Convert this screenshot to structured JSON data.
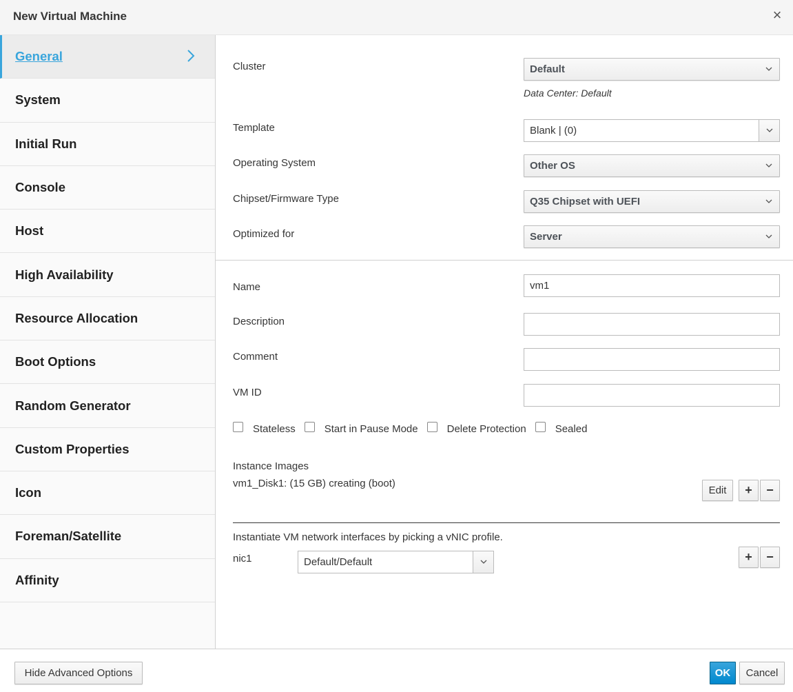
{
  "dialog": {
    "title": "New Virtual Machine",
    "close_icon": "close-icon",
    "close_glyph": "×"
  },
  "sidebar": {
    "items": [
      {
        "label": "General",
        "active": true
      },
      {
        "label": "System"
      },
      {
        "label": "Initial Run"
      },
      {
        "label": "Console"
      },
      {
        "label": "Host"
      },
      {
        "label": "High Availability"
      },
      {
        "label": "Resource Allocation"
      },
      {
        "label": "Boot Options"
      },
      {
        "label": "Random Generator"
      },
      {
        "label": "Custom Properties"
      },
      {
        "label": "Icon"
      },
      {
        "label": "Foreman/Satellite"
      },
      {
        "label": "Affinity"
      }
    ],
    "active_icon": "chevron-right-icon"
  },
  "general": {
    "cluster": {
      "label": "Cluster",
      "value": "Default",
      "note": "Data Center: Default"
    },
    "template": {
      "label": "Template",
      "value": "Blank |  (0)"
    },
    "os": {
      "label": "Operating System",
      "value": "Other OS"
    },
    "chipset": {
      "label": "Chipset/Firmware Type",
      "value": "Q35 Chipset with UEFI"
    },
    "optimized": {
      "label": "Optimized for",
      "value": "Server"
    },
    "name": {
      "label": "Name",
      "value": "vm1"
    },
    "description": {
      "label": "Description",
      "value": ""
    },
    "comment": {
      "label": "Comment",
      "value": ""
    },
    "vm_id": {
      "label": "VM ID",
      "value": ""
    },
    "checkboxes": {
      "stateless": {
        "label": "Stateless",
        "checked": false
      },
      "pause": {
        "label": "Start in Pause Mode",
        "checked": false
      },
      "delete_protection": {
        "label": "Delete Protection",
        "checked": false
      },
      "sealed": {
        "label": "Sealed",
        "checked": false
      }
    },
    "instance_images": {
      "label": "Instance Images",
      "disk": "vm1_Disk1: (15 GB) creating (boot)",
      "edit_label": "Edit",
      "plus_glyph": "+",
      "minus_glyph": "−"
    },
    "nics": {
      "intro": "Instantiate VM network interfaces by picking a vNIC profile.",
      "nic_label": "nic1",
      "nic_value": "Default/Default"
    }
  },
  "footer": {
    "hide_advanced_label": "Hide Advanced Options",
    "ok_label": "OK",
    "cancel_label": "Cancel"
  },
  "colors": {
    "accent": "#39a5dc",
    "primary": "#0088ce"
  }
}
